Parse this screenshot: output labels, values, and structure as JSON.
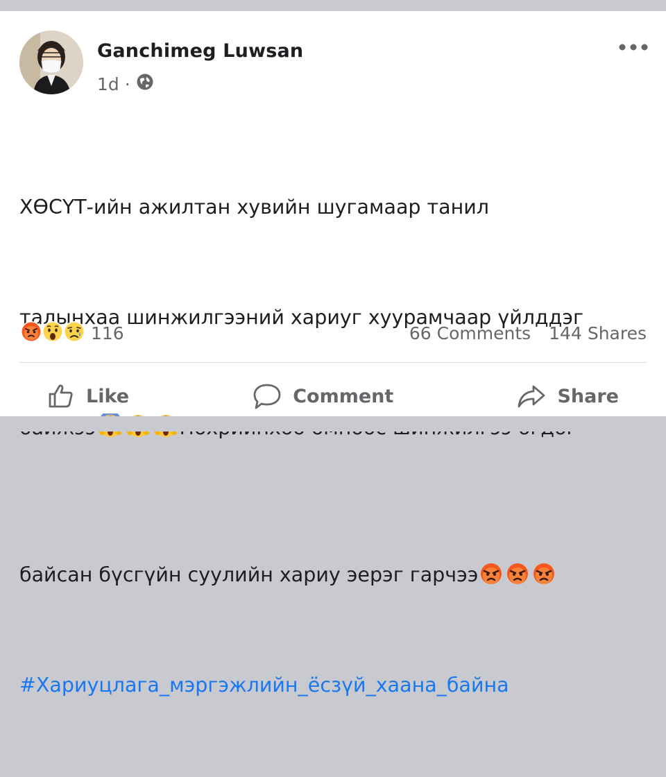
{
  "post": {
    "author": "Ganchimeg Luwsan",
    "time": "1d",
    "separator": "·",
    "audience_icon": "globe-icon",
    "lines": [
      "ХӨСҮТ-ийн ажилтан хувийн шугамаар танил",
      "талынхаа шинжилгээний хариуг хуурамчаар үйлддэг",
      "байжээ",
      "Нөхрийнхөө өмнөөс шинжилгээ өгдөг",
      "байсан бүсгүйн суулийн хариу эерэг гарчээ"
    ],
    "hashtag": "#Хариуцлага_мэргэжлийн_ёсзүй_хаана_байна",
    "emoji": {
      "line3": [
        "screaming-face-emoji",
        "screaming-face-emoji",
        "screaming-face-emoji"
      ],
      "line5": [
        "angry-face-emoji",
        "angry-face-emoji",
        "angry-face-emoji"
      ]
    }
  },
  "stats": {
    "reaction_icons": [
      "angry-reaction-icon",
      "wow-reaction-icon",
      "sad-reaction-icon"
    ],
    "reaction_count": "116",
    "comments": "66 Comments",
    "shares": "144 Shares"
  },
  "actions": {
    "like": "Like",
    "comment": "Comment",
    "share": "Share"
  },
  "colors": {
    "text": "#1c1e21",
    "secondary": "#65676b",
    "link": "#1877f2",
    "divider": "#dadde1",
    "frame": "#c9cacf"
  }
}
